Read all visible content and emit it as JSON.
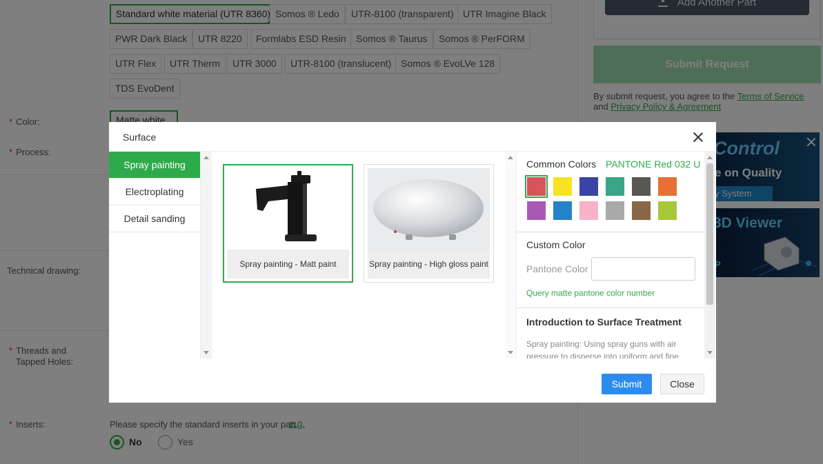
{
  "materials": [
    {
      "label": "Standard white material (UTR 8360)",
      "selected": true
    },
    {
      "label": "Somos ® Ledo",
      "selected": false
    },
    {
      "label": "UTR-8100 (transparent)",
      "selected": false
    },
    {
      "label": "UTR Imagine Black",
      "selected": false
    },
    {
      "label": "PWR Dark Black",
      "selected": false
    },
    {
      "label": "UTR 8220",
      "selected": false
    },
    {
      "label": "Formlabs ESD Resin",
      "selected": false
    },
    {
      "label": "Somos ® Taurus",
      "selected": false
    },
    {
      "label": "Somos ® PerFORM",
      "selected": false
    },
    {
      "label": "UTR Flex",
      "selected": false
    },
    {
      "label": "UTR Therm",
      "selected": false
    },
    {
      "label": "UTR 3000",
      "selected": false
    },
    {
      "label": "UTR-8100 (translucent)",
      "selected": false
    },
    {
      "label": "Somos ® EvoLVe 128",
      "selected": false
    },
    {
      "label": "TDS EvoDent",
      "selected": false
    }
  ],
  "form": {
    "required_mark": "*",
    "color_label": "Color:",
    "color_value": "Matte white",
    "process_label": "Process:",
    "technical_drawing_label": "Technical drawing:",
    "threads_label_1": "Threads and",
    "threads_label_2": "Tapped Holes:",
    "inserts_label": "Inserts:",
    "inserts_hint": "Please specify the standard inserts in your part.",
    "inserts_example_link": "e.g.",
    "inserts_options": [
      {
        "label": "No",
        "checked": true
      },
      {
        "label": "Yes",
        "checked": false
      }
    ]
  },
  "sidebar": {
    "add_part_label": "Add Another Part",
    "submit_request_label": "Submit Request",
    "terms_prefix": "By submit request, you agree to the",
    "terms_link": "Terms of Service",
    "terms_and": "and",
    "privacy_link": "Privacy Policy & Agreement",
    "ad1_title": "Control",
    "ad1_subtitle": "e on Quality",
    "ad1_footer": "y System",
    "ad2_title": "3D Viewer",
    "ad2_footer": "P"
  },
  "modal": {
    "title": "Surface",
    "tabs": [
      {
        "label": "Spray painting",
        "active": true
      },
      {
        "label": "Electroplating",
        "active": false
      },
      {
        "label": "Detail sanding",
        "active": false
      }
    ],
    "options": [
      {
        "caption": "Spray painting - Matt paint",
        "selected": true,
        "icon": "faucet-image"
      },
      {
        "caption": "Spray painting - High gloss paint",
        "selected": false,
        "icon": "gloss-object-image"
      }
    ],
    "common_colors_label": "Common Colors",
    "selected_pantone": "PANTONE Red 032 U",
    "swatches": [
      "#d9535a",
      "#f8e223",
      "#3a43a6",
      "#3ba587",
      "#595853",
      "#e87035",
      "#a958b8",
      "#2482c8",
      "#f8b2c6",
      "#a9a9a9",
      "#8a6649",
      "#a7c83a"
    ],
    "selected_swatch_index": 0,
    "custom_color_label": "Custom Color",
    "pantone_color_label": "Pantone Color",
    "pantone_input_value": "",
    "query_link": "Query matte pantone color number",
    "intro_title": "Introduction to Surface Treatment",
    "intro_text": "Spray painting: Using spray guns with air pressure to disperse into uniform and fine",
    "submit_label": "Submit",
    "close_label": "Close",
    "accent_color": "#2eaa4a",
    "submit_color": "#2d8ceb"
  }
}
